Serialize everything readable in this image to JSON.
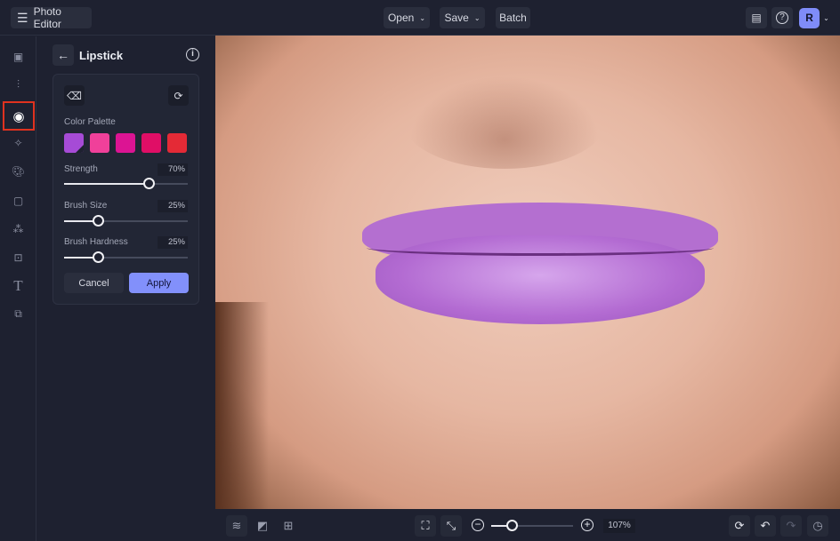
{
  "app": {
    "title": "Photo Editor",
    "avatar_initial": "R"
  },
  "toolbar": {
    "open": "Open",
    "save": "Save",
    "batch": "Batch"
  },
  "rail": {
    "items": [
      "image",
      "adjustments",
      "retouch",
      "effects",
      "artsy",
      "frames",
      "graphics",
      "overlays",
      "text",
      "more"
    ],
    "active": "retouch",
    "active_color": "#e0321f"
  },
  "panel": {
    "title": "Lipstick",
    "palette_label": "Color Palette",
    "palette": [
      "#a64bd6",
      "#f0409a",
      "#dc1493",
      "#e00e66",
      "#e42a36"
    ],
    "sliders": [
      {
        "label": "Strength",
        "value": "70%",
        "fraction": 0.7
      },
      {
        "label": "Brush Size",
        "value": "25%",
        "fraction": 0.25
      },
      {
        "label": "Brush Hardness",
        "value": "25%",
        "fraction": 0.25
      }
    ],
    "cancel": "Cancel",
    "apply": "Apply",
    "accent": "#8290fb"
  },
  "bottom": {
    "zoom": "107%",
    "zoom_fraction": 0.2
  }
}
